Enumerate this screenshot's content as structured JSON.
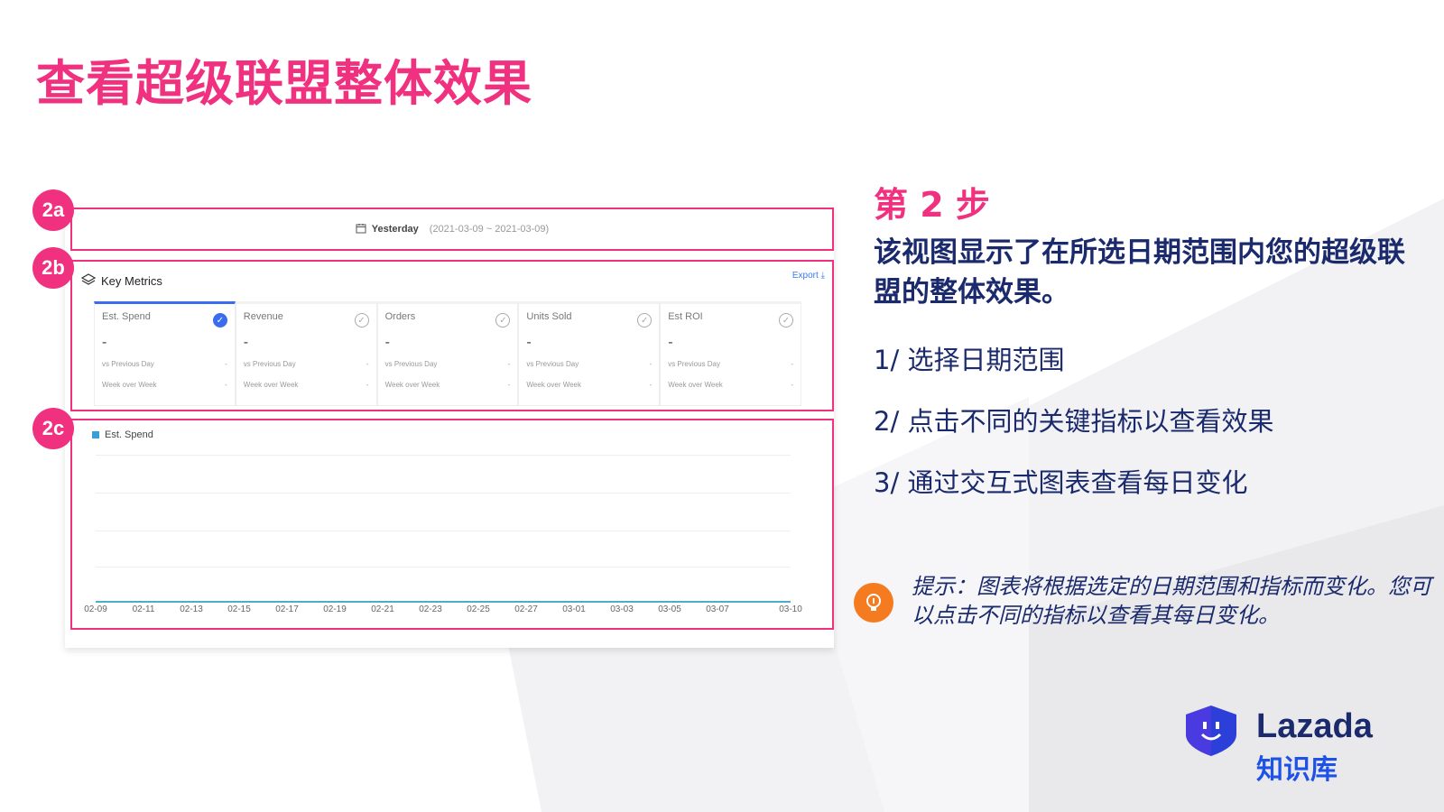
{
  "title": "查看超级联盟整体效果",
  "badges": {
    "a": "2a",
    "b": "2b",
    "c": "2c"
  },
  "date_selector": {
    "label": "Yesterday",
    "range": "(2021-03-09 ~ 2021-03-09)"
  },
  "key_metrics": {
    "heading": "Key Metrics",
    "export_label": "Export ⤓",
    "items": [
      {
        "name": "Est. Spend",
        "value": "-",
        "row1_label": "vs Previous Day",
        "row1_value": "-",
        "row2_label": "Week over Week",
        "row2_value": "-"
      },
      {
        "name": "Revenue",
        "value": "-",
        "row1_label": "vs Previous Day",
        "row1_value": "-",
        "row2_label": "Week over Week",
        "row2_value": "-"
      },
      {
        "name": "Orders",
        "value": "-",
        "row1_label": "vs Previous Day",
        "row1_value": "-",
        "row2_label": "Week over Week",
        "row2_value": "-"
      },
      {
        "name": "Units Sold",
        "value": "-",
        "row1_label": "vs Previous Day",
        "row1_value": "-",
        "row2_label": "Week over Week",
        "row2_value": "-"
      },
      {
        "name": "Est ROI",
        "value": "-",
        "row1_label": "vs Previous Day",
        "row1_value": "-",
        "row2_label": "Week over Week",
        "row2_value": "-"
      }
    ]
  },
  "chart": {
    "legend": "Est. Spend",
    "x_ticks": [
      "02-09",
      "02-11",
      "02-13",
      "02-15",
      "02-17",
      "02-19",
      "02-21",
      "02-23",
      "02-25",
      "02-27",
      "03-01",
      "03-03",
      "03-05",
      "03-07",
      "03-10"
    ]
  },
  "step": {
    "label": "第 2 步",
    "description": "该视图显示了在所选日期范围内您的超级联盟的整体效果。",
    "items": [
      "1/ 选择日期范围",
      "2/ 点击不同的关键指标以查看效果",
      "3/ 通过交互式图表查看每日变化"
    ]
  },
  "tip": "提示：图表将根据选定的日期范围和指标而变化。您可以点击不同的指标以查看其每日变化。",
  "logo": {
    "word": "Lazada",
    "sub": "知识库"
  },
  "colors": {
    "accent": "#f0317f",
    "navy": "#1a2a6c",
    "blue": "#3b6cf0",
    "tip": "#f47b20"
  }
}
